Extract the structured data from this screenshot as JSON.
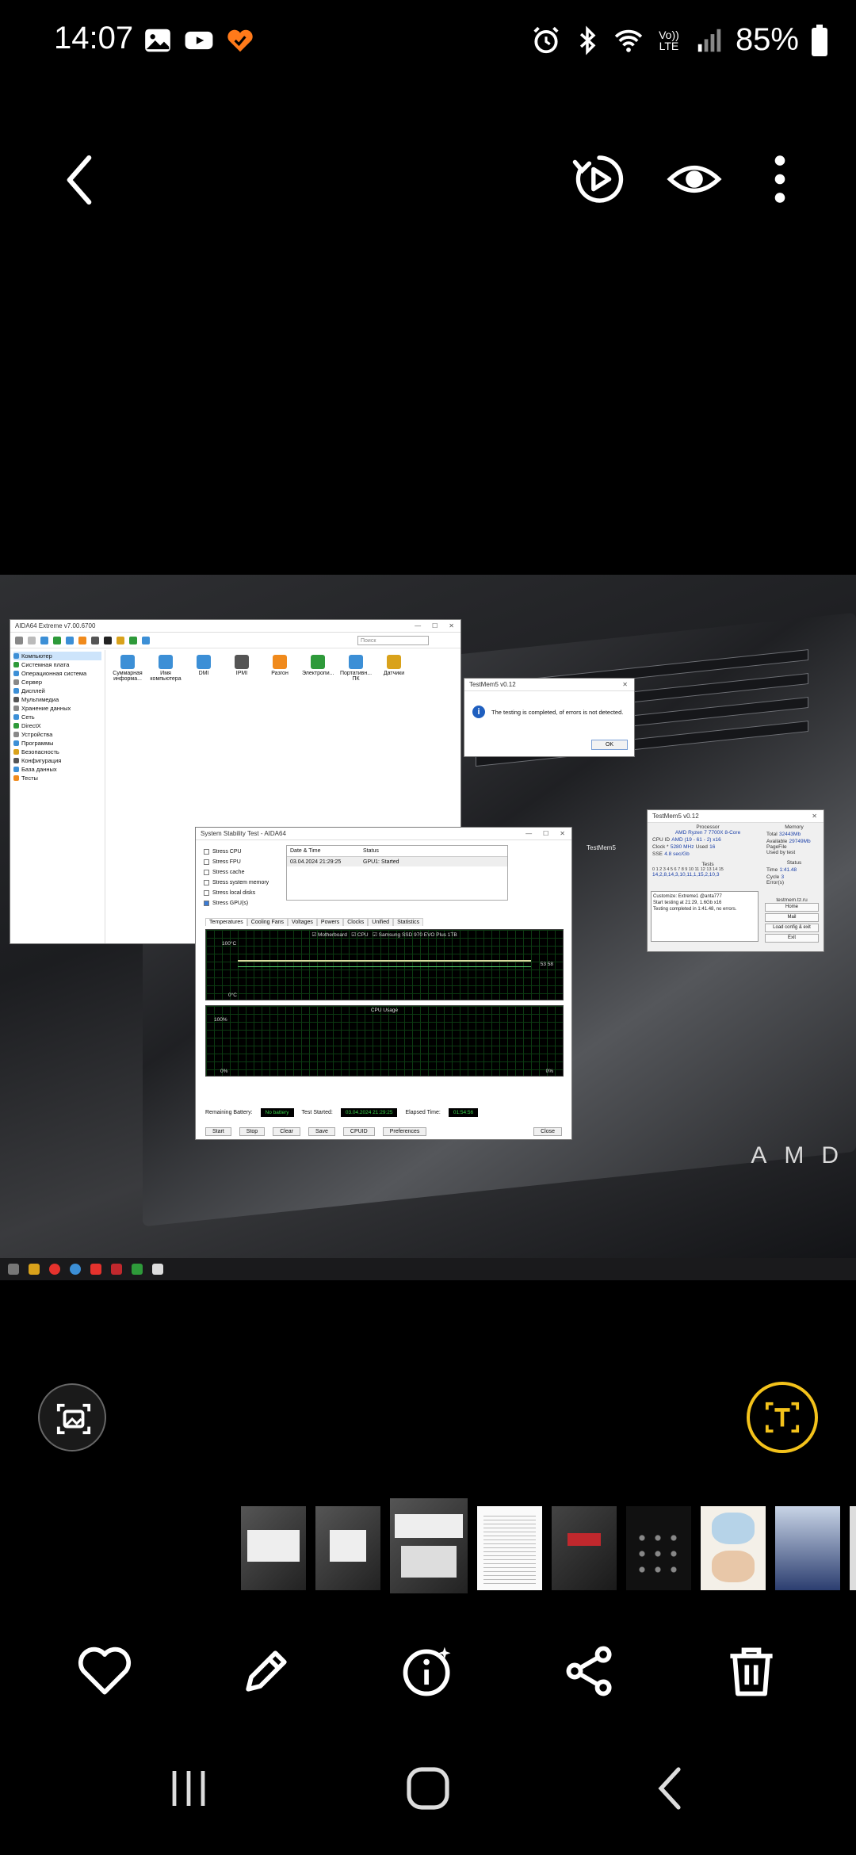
{
  "status_bar": {
    "time": "14:07",
    "battery": "85%",
    "left_icons": [
      "gallery-icon",
      "youtube-icon",
      "app-heart-icon"
    ],
    "right_icons": [
      "alarm-icon",
      "bluetooth-icon",
      "wifi-icon",
      "volte-icon",
      "signal-icon",
      "battery-icon"
    ],
    "volte_label": "Vo)) LTE"
  },
  "top_bar": {
    "icons": [
      "back-icon",
      "remaster-play-icon",
      "eye-icon",
      "more-icon"
    ]
  },
  "screenshot": {
    "aida_window": {
      "title": "AIDA64 Extreme v7.00.6700",
      "search_placeholder": "Поиск",
      "tree_items": [
        "Компьютер",
        "Системная плата",
        "Операционная система",
        "Сервер",
        "Дисплей",
        "Мультимедиа",
        "Хранение данных",
        "Сеть",
        "DirectX",
        "Устройства",
        "Программы",
        "Безопасность",
        "Конфигурация",
        "База данных",
        "Тесты"
      ],
      "icons": [
        {
          "label": "Суммарная информа...",
          "color": "#3c8fd6"
        },
        {
          "label": "Имя компьютера",
          "color": "#3c8fd6"
        },
        {
          "label": "DMI",
          "color": "#3c8fd6"
        },
        {
          "label": "IPMI",
          "color": "#555555"
        },
        {
          "label": "Разгон",
          "color": "#f08a1c"
        },
        {
          "label": "Электропи...",
          "color": "#2e9a3a"
        },
        {
          "label": "Портативн... ПК",
          "color": "#3c8fd6"
        },
        {
          "label": "Датчики",
          "color": "#d9a21b"
        }
      ]
    },
    "testmem_popup": {
      "title": "TestMem5 v0.12",
      "message": "The testing is completed, of errors is not detected.",
      "ok_label": "OK"
    },
    "stability_test": {
      "title": "System Stability Test - AIDA64",
      "checks": [
        {
          "label": "Stress CPU",
          "on": false
        },
        {
          "label": "Stress FPU",
          "on": false
        },
        {
          "label": "Stress cache",
          "on": false
        },
        {
          "label": "Stress system memory",
          "on": false
        },
        {
          "label": "Stress local disks",
          "on": false
        },
        {
          "label": "Stress GPU(s)",
          "on": true
        }
      ],
      "table_headers": [
        "Date & Time",
        "Status"
      ],
      "table_row": [
        "03.04.2024 21:29:25",
        "GPU1: Started"
      ],
      "tabs": [
        "Temperatures",
        "Cooling Fans",
        "Voltages",
        "Powers",
        "Clocks",
        "Unified",
        "Statistics"
      ],
      "legend": [
        "Motherboard",
        "CPU",
        "Samsung SSD 970 EVO Plus 1TB"
      ],
      "temp_top": "100°C",
      "temp_bottom": "0°C",
      "temp_value": "53 58",
      "cpu_title": "CPU Usage",
      "cpu_top": "100%",
      "cpu_bottom": "0%",
      "cpu_right": "0%",
      "battery_label": "Remaining Battery:",
      "battery_value": "No battery",
      "started_label": "Test Started:",
      "started_value": "03.04.2024 21:29:25",
      "elapsed_label": "Elapsed Time:",
      "elapsed_value": "01:54:56",
      "buttons": [
        "Start",
        "Stop",
        "Clear",
        "Save",
        "CPUID",
        "Preferences",
        "Close"
      ]
    },
    "testmem5": {
      "title": "TestMem5 v0.12",
      "processor_header": "Processor",
      "processor": "AMD Ryzen 7 7700X 8-Core",
      "cpu_id_label": "CPU ID",
      "cpu_id": "AMD (19 - 61 - 2) x16",
      "clock_label": "Clock *",
      "clock": "5280 MHz",
      "used_label": "Used",
      "used": "16",
      "sse_label": "SSE",
      "sse": "4.8 sec/Gb",
      "memory_header": "Memory",
      "total_label": "Total",
      "total": "32443Mb",
      "available_label": "Available",
      "available": "29749Mb",
      "pagefile_label": "PageFile",
      "usedbytest_label": "Used by test",
      "tests_header": "Tests",
      "tests_numbers": "0 1 2 3 4 5 6 7 8 9 10 11 12 13 14 15",
      "tests_sequence": "14,2,8,14,3,10,11,1,15,2,10,3",
      "status_header": "Status",
      "time_label": "Time",
      "time": "1:41.48",
      "cycle_label": "Cycle",
      "cycle": "3",
      "errors_label": "Error(s)",
      "log": [
        "Customize: Extreme1 @anta777",
        "Start testing at 21:29, 1.6Gb x16",
        "Testing completed in 1:41.48, no errors."
      ],
      "site": "testmem.tz.ru",
      "buttons": [
        "Home",
        "Mail",
        "Load config & exit",
        "Exit"
      ]
    },
    "desktop_label": "TestMem5",
    "brand": "AMD"
  },
  "tools": {
    "left_icon": "image-scan-icon",
    "right_icon": "text-extract-icon",
    "accent": "#f3c21b"
  },
  "actions": [
    "heart-icon",
    "edit-icon",
    "info-icon",
    "share-icon",
    "trash-icon"
  ],
  "nav": [
    "recents-icon",
    "home-icon",
    "back-nav-icon"
  ]
}
